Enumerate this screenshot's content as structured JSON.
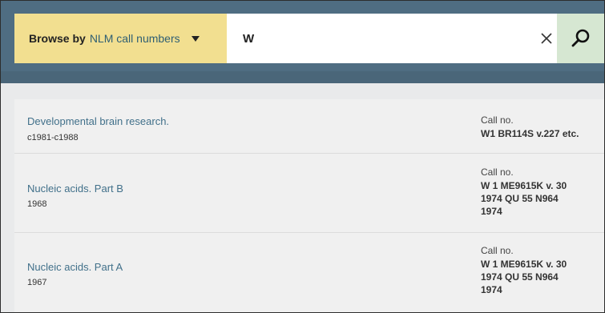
{
  "search": {
    "browse_prefix": "Browse by",
    "browse_value": "NLM call numbers",
    "query": "W",
    "clear_icon": "close-icon",
    "search_icon": "search-icon"
  },
  "results": [
    {
      "title": "Developmental brain research.",
      "date": "c1981-c1988",
      "callno_label": "Call no.",
      "callno_value": "W1 BR114S v.227 etc."
    },
    {
      "title": "Nucleic acids. Part B",
      "date": "1968",
      "callno_label": "Call no.",
      "callno_value": "W 1 ME9615K v. 30\n1974 QU 55 N964\n1974"
    },
    {
      "title": "Nucleic acids. Part A",
      "date": "1967",
      "callno_label": "Call no.",
      "callno_value": "W 1 ME9615K v. 30\n1974 QU 55 N964\n1974"
    }
  ],
  "colors": {
    "header": "#4f6d82",
    "browse_bg": "#f2df90",
    "search_button_bg": "#d6e7d2",
    "link": "#41708a"
  }
}
